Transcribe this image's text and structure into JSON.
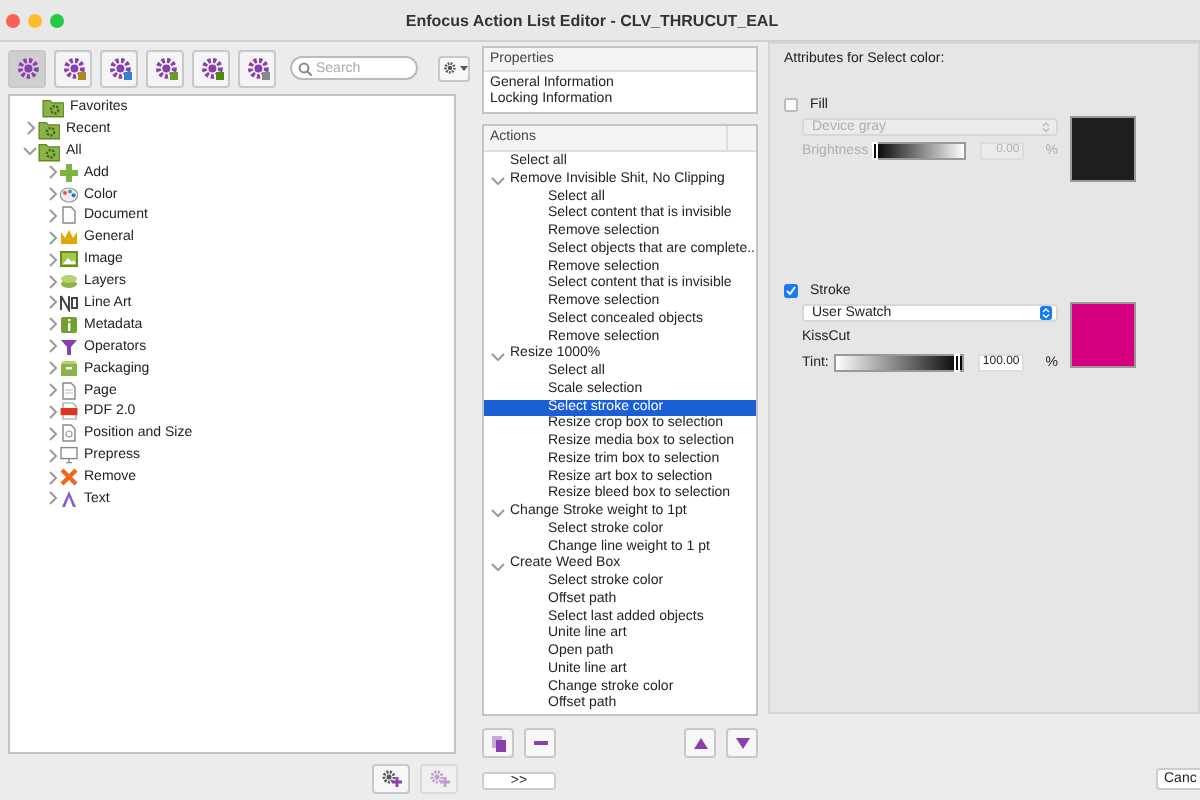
{
  "window": {
    "title": "Enfocus Action List Editor - CLV_THRUCUT_EAL"
  },
  "toolbar": {
    "buttons": [
      {
        "selected": true
      },
      {
        "selected": false
      },
      {
        "selected": false
      },
      {
        "selected": false
      },
      {
        "selected": false
      },
      {
        "selected": false
      }
    ],
    "search": {
      "placeholder": "Search"
    }
  },
  "tree": {
    "items": [
      {
        "label": "Favorites"
      },
      {
        "label": "Recent",
        "expanded": false
      },
      {
        "label": "All",
        "expanded": true,
        "children": [
          {
            "label": "Add",
            "expanded": false
          },
          {
            "label": "Color",
            "expanded": false
          },
          {
            "label": "Document",
            "expanded": false
          },
          {
            "label": "General",
            "expanded": false
          },
          {
            "label": "Image",
            "expanded": false
          },
          {
            "label": "Layers",
            "expanded": false
          },
          {
            "label": "Line Art",
            "expanded": false
          },
          {
            "label": "Metadata",
            "expanded": false
          },
          {
            "label": "Operators",
            "expanded": false
          },
          {
            "label": "Packaging",
            "expanded": false
          },
          {
            "label": "Page",
            "expanded": false
          },
          {
            "label": "PDF 2.0",
            "expanded": false
          },
          {
            "label": "Position and Size",
            "expanded": false
          },
          {
            "label": "Prepress",
            "expanded": false
          },
          {
            "label": "Remove",
            "expanded": false
          },
          {
            "label": "Text",
            "expanded": false
          }
        ]
      }
    ]
  },
  "properties": {
    "header": "Properties",
    "items": [
      {
        "label": "General Information",
        "selected": false
      },
      {
        "label": "Locking Information",
        "selected": false
      }
    ]
  },
  "actions": {
    "header": "Actions",
    "items": [
      {
        "label": "Select all",
        "selected": false
      },
      {
        "label": "Remove Invisible Shit, No Clipping",
        "selected": false,
        "expanded": true,
        "children": [
          {
            "label": "Select all",
            "selected": false
          },
          {
            "label": "Select content that is invisible",
            "selected": false
          },
          {
            "label": "Remove selection",
            "selected": false
          },
          {
            "label": "Select objects that are complete...",
            "selected": false
          },
          {
            "label": "Remove selection",
            "selected": false
          },
          {
            "label": "Select content that is invisible",
            "selected": false
          },
          {
            "label": "Remove selection",
            "selected": false
          },
          {
            "label": "Select concealed objects",
            "selected": false
          },
          {
            "label": "Remove selection",
            "selected": false
          }
        ]
      },
      {
        "label": "Resize 1000%",
        "selected": false,
        "expanded": true,
        "children": [
          {
            "label": "Select all",
            "selected": false
          },
          {
            "label": "Scale selection",
            "selected": false
          },
          {
            "label": "Select stroke color",
            "selected": true
          },
          {
            "label": "Resize crop box to selection",
            "selected": false
          },
          {
            "label": "Resize media box to selection",
            "selected": false
          },
          {
            "label": "Resize trim box to selection",
            "selected": false
          },
          {
            "label": "Resize art box to selection",
            "selected": false
          },
          {
            "label": "Resize bleed box to selection",
            "selected": false
          }
        ]
      },
      {
        "label": "Change Stroke weight to 1pt",
        "selected": false,
        "expanded": true,
        "children": [
          {
            "label": "Select stroke color",
            "selected": false
          },
          {
            "label": "Change line weight to 1 pt",
            "selected": false
          }
        ]
      },
      {
        "label": "Create Weed Box",
        "selected": false,
        "expanded": true,
        "children": [
          {
            "label": "Select stroke color",
            "selected": false
          },
          {
            "label": "Offset path",
            "selected": false
          },
          {
            "label": "Select last added objects",
            "selected": false
          },
          {
            "label": "Unite line art",
            "selected": false
          },
          {
            "label": "Open path",
            "selected": false
          },
          {
            "label": "Unite line art",
            "selected": false
          },
          {
            "label": "Change stroke color",
            "selected": false
          },
          {
            "label": "Offset path",
            "selected": false
          }
        ]
      }
    ]
  },
  "more_button": ">>",
  "attributes": {
    "title": "Attributes for Select color:",
    "sections": [
      {
        "kind": "fill",
        "label": "Fill",
        "checked": false,
        "color_model": "Device gray",
        "slider_label": "Brightness",
        "level": 0,
        "value": "0.00",
        "unit": "%",
        "color": "#1e1e1e"
      },
      {
        "kind": "stroke",
        "label": "Stroke",
        "checked": true,
        "color_model": "User Swatch",
        "swatch_name": "KissCut",
        "slider_label": "Tint:",
        "level": 1,
        "value": "100.00",
        "unit": "%",
        "color": "#d4007f"
      }
    ]
  },
  "cancel_button": "Canc"
}
